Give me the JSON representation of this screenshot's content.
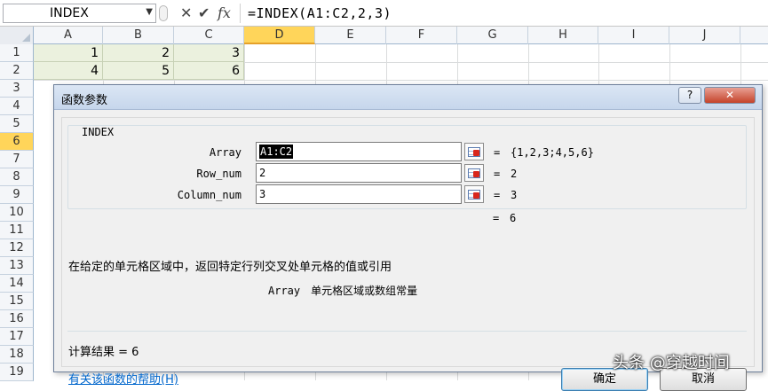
{
  "formula_bar": {
    "name_box": "INDEX",
    "cancel_glyph": "✕",
    "enter_glyph": "✔",
    "fx_glyph": "fx",
    "formula": "=INDEX(A1:C2,2,3)"
  },
  "sheet": {
    "columns": [
      "A",
      "B",
      "C",
      "D",
      "E",
      "F",
      "G",
      "H",
      "I",
      "J"
    ],
    "active_column": "D",
    "rows": [
      "1",
      "2",
      "3",
      "4",
      "5",
      "6",
      "7",
      "8",
      "9",
      "10",
      "11",
      "12",
      "13",
      "14",
      "15",
      "16",
      "17",
      "18",
      "19"
    ],
    "active_row": "6",
    "cells": {
      "A1": "1",
      "B1": "2",
      "C1": "3",
      "A2": "4",
      "B2": "5",
      "C2": "6"
    },
    "cell_fill_color": "#ebf1de"
  },
  "dialog": {
    "title": "函数参数",
    "help_button": "?",
    "close_button": "✕",
    "function_name": "INDEX",
    "args": [
      {
        "label": "Array",
        "value": "A1:C2",
        "result": "{1,2,3;4,5,6}"
      },
      {
        "label": "Row_num",
        "value": "2",
        "result": "2"
      },
      {
        "label": "Column_num",
        "value": "3",
        "result": "3"
      }
    ],
    "equals": "=",
    "formula_result_line": "6",
    "description": "在给定的单元格区域中，返回特定行列交叉处单元格的值或引用",
    "param_name": "Array",
    "param_description": "单元格区域或数组常量",
    "calc_result": "计算结果 =  6",
    "help_link": "有关该函数的帮助(H)",
    "ok_button": "确定",
    "cancel_button": "取消"
  },
  "watermark": "头条 @穿越时间"
}
